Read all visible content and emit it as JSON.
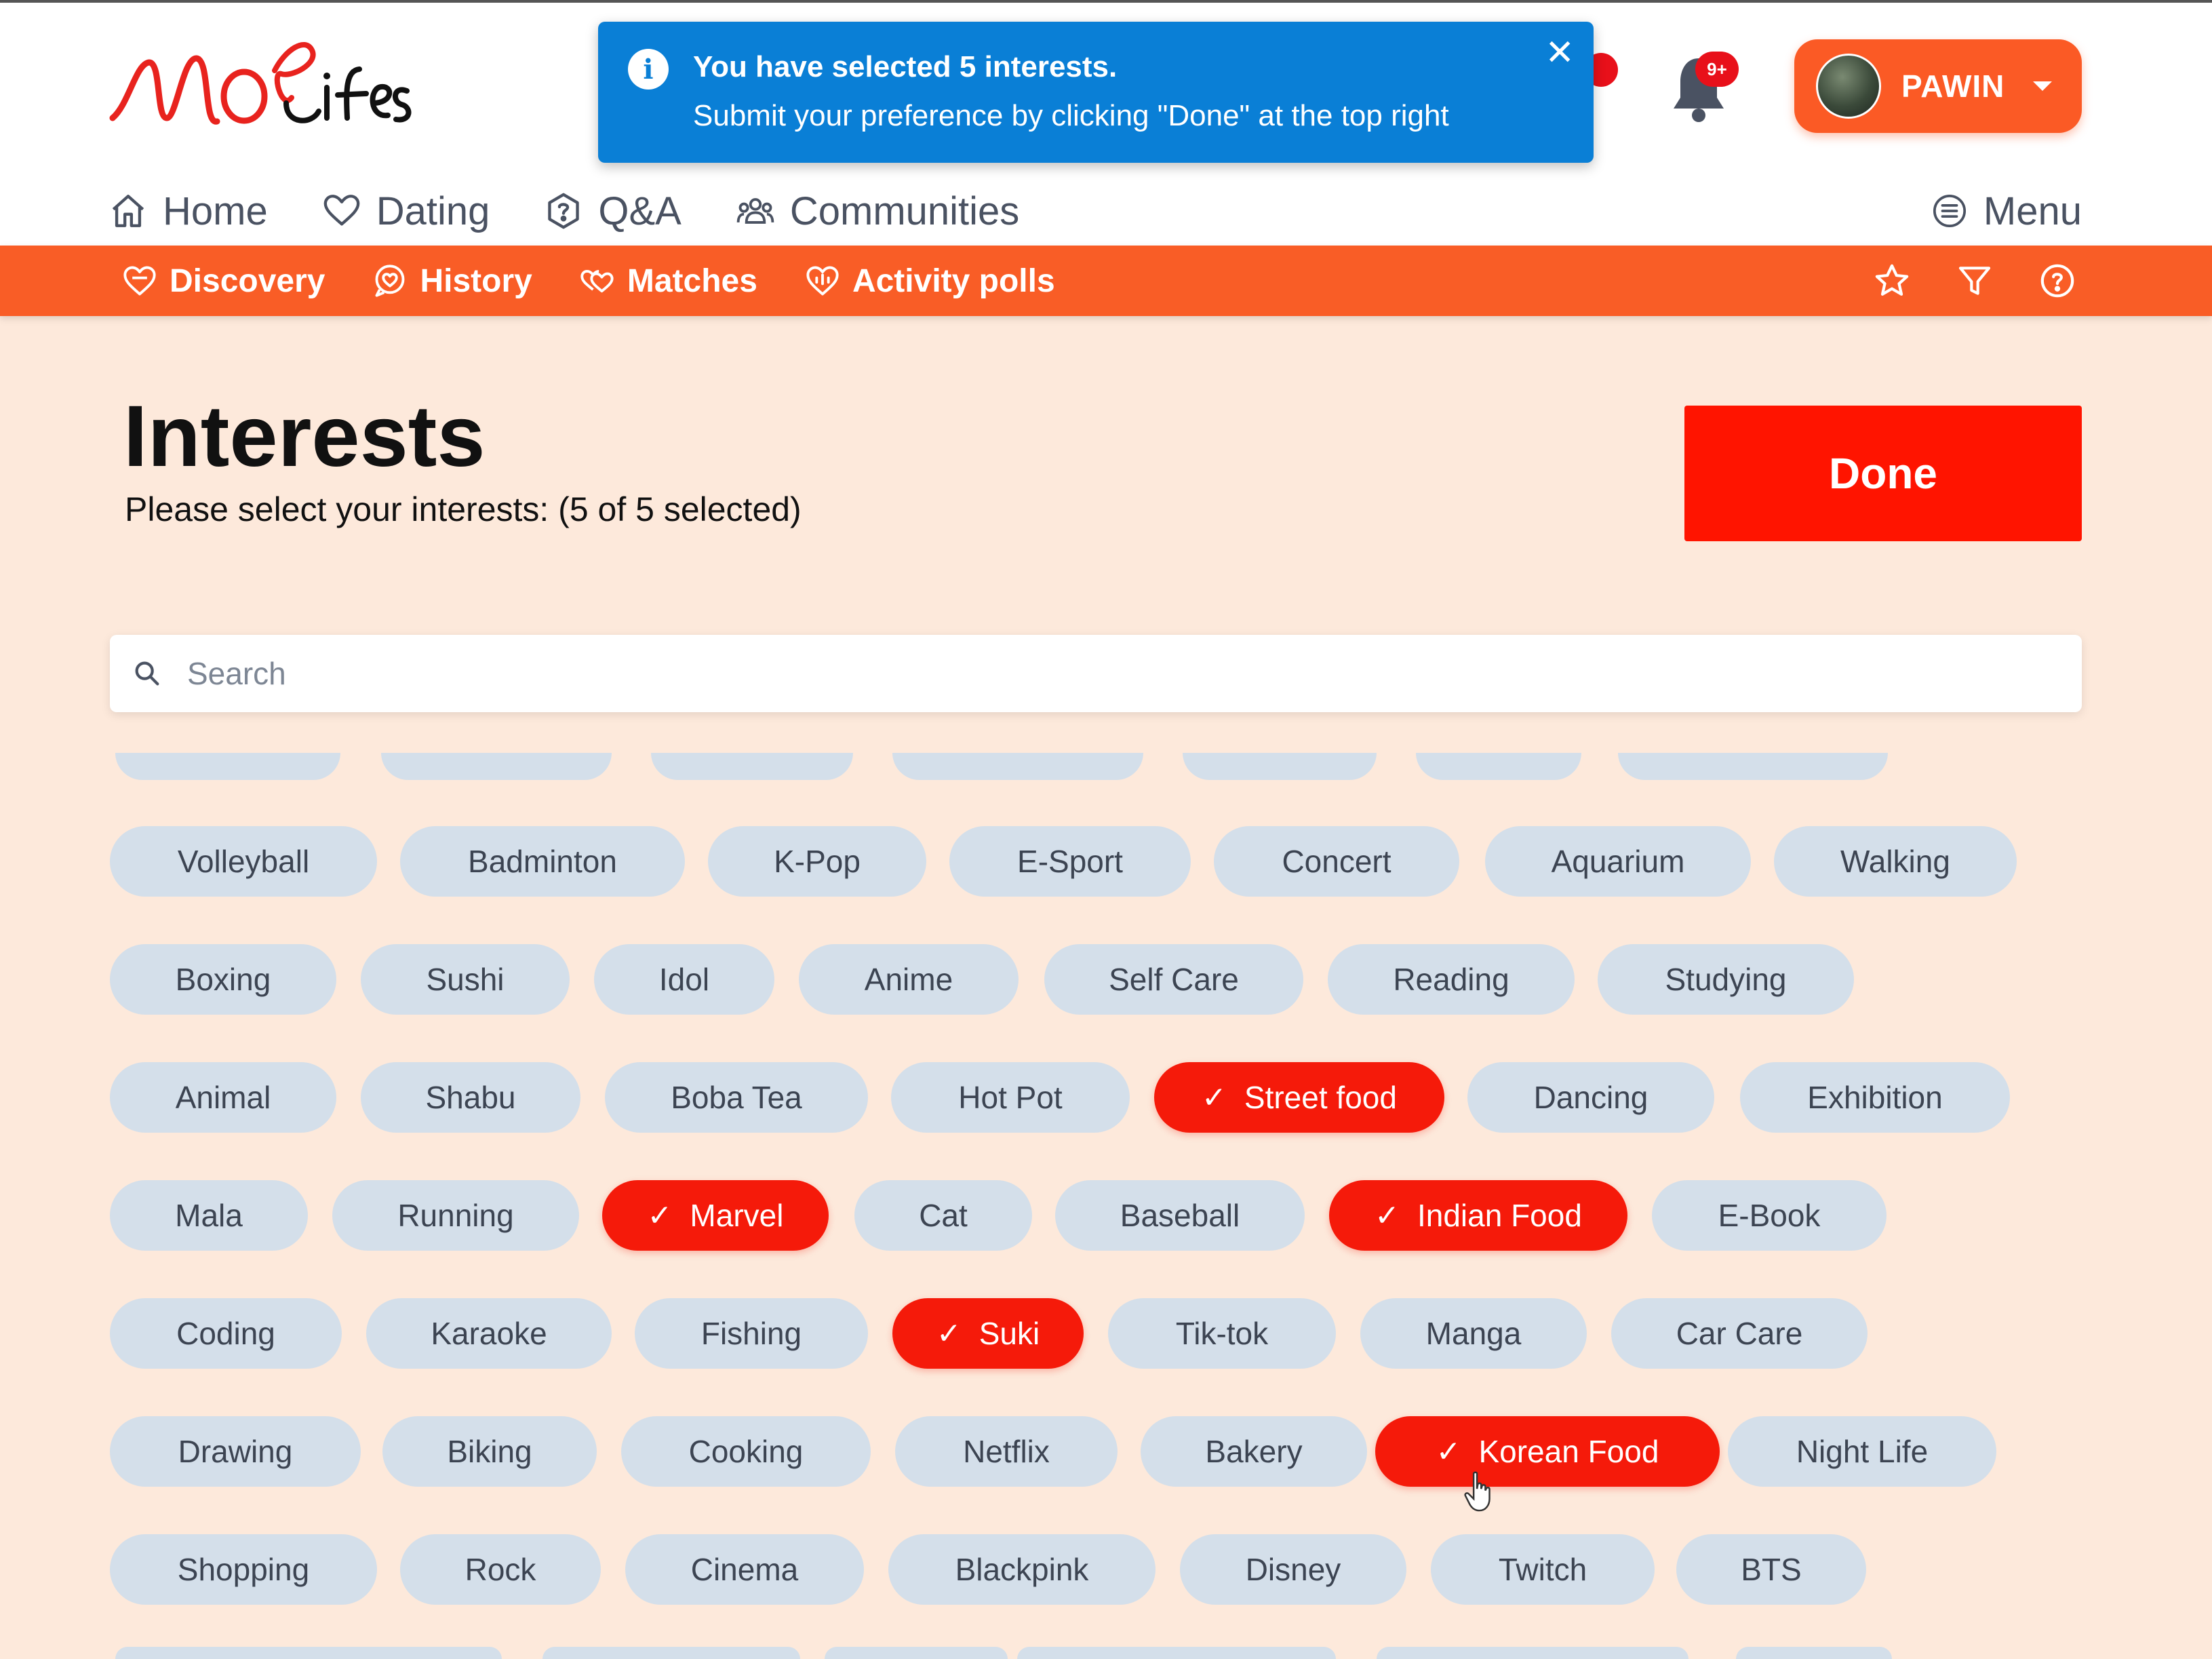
{
  "notification": {
    "line1": "You have selected 5 interests.",
    "line2": "Submit your preference by clicking \"Done\" at the top right",
    "close": "✕"
  },
  "header": {
    "bell_badge": "9+",
    "user_name": "PAWIN"
  },
  "nav": {
    "items": [
      {
        "label": "Home",
        "icon": "home-icon"
      },
      {
        "label": "Dating",
        "icon": "heart-icon"
      },
      {
        "label": "Q&A",
        "icon": "question-icon"
      },
      {
        "label": "Communities",
        "icon": "people-icon"
      }
    ],
    "menu": "Menu"
  },
  "subnav": {
    "items": [
      {
        "label": "Discovery",
        "icon": "heart-badge-icon"
      },
      {
        "label": "History",
        "icon": "heart-chat-icon"
      },
      {
        "label": "Matches",
        "icon": "double-heart-icon"
      },
      {
        "label": "Activity polls",
        "icon": "poll-heart-icon"
      }
    ],
    "action_icons": [
      "star-icon",
      "filter-icon",
      "help-icon"
    ]
  },
  "page": {
    "title": "Interests",
    "subtitle": "Please select your interests: (5 of 5 selected)",
    "done": "Done"
  },
  "search": {
    "placeholder": "Search",
    "value": ""
  },
  "colors": {
    "accent": "#f95d26",
    "selected": "#f51a0a",
    "chip": "#d4dfea",
    "background": "#fde9db",
    "toast": "#0a7fd6"
  },
  "interests": {
    "rows": [
      [
        "Volleyball",
        "Badminton",
        "K-Pop",
        "E-Sport",
        "Concert",
        "Aquarium",
        "Walking"
      ],
      [
        "Boxing",
        "Sushi",
        "Idol",
        "Anime",
        "Self Care",
        "Reading",
        "Studying"
      ],
      [
        "Animal",
        "Shabu",
        "Boba Tea",
        "Hot Pot",
        "Street food",
        "Dancing",
        "Exhibition"
      ],
      [
        "Mala",
        "Running",
        "Marvel",
        "Cat",
        "Baseball",
        "Indian Food",
        "E-Book"
      ],
      [
        "Coding",
        "Karaoke",
        "Fishing",
        "Suki",
        "Tik-tok",
        "Manga",
        "Car Care"
      ],
      [
        "Drawing",
        "Biking",
        "Cooking",
        "Netflix",
        "Bakery",
        "Korean Food",
        "Night Life"
      ],
      [
        "Shopping",
        "Rock",
        "Cinema",
        "Blackpink",
        "Disney",
        "Twitch",
        "BTS"
      ]
    ],
    "selected": [
      "Street food",
      "Marvel",
      "Indian Food",
      "Suki",
      "Korean Food"
    ],
    "check_mark": "✓"
  }
}
